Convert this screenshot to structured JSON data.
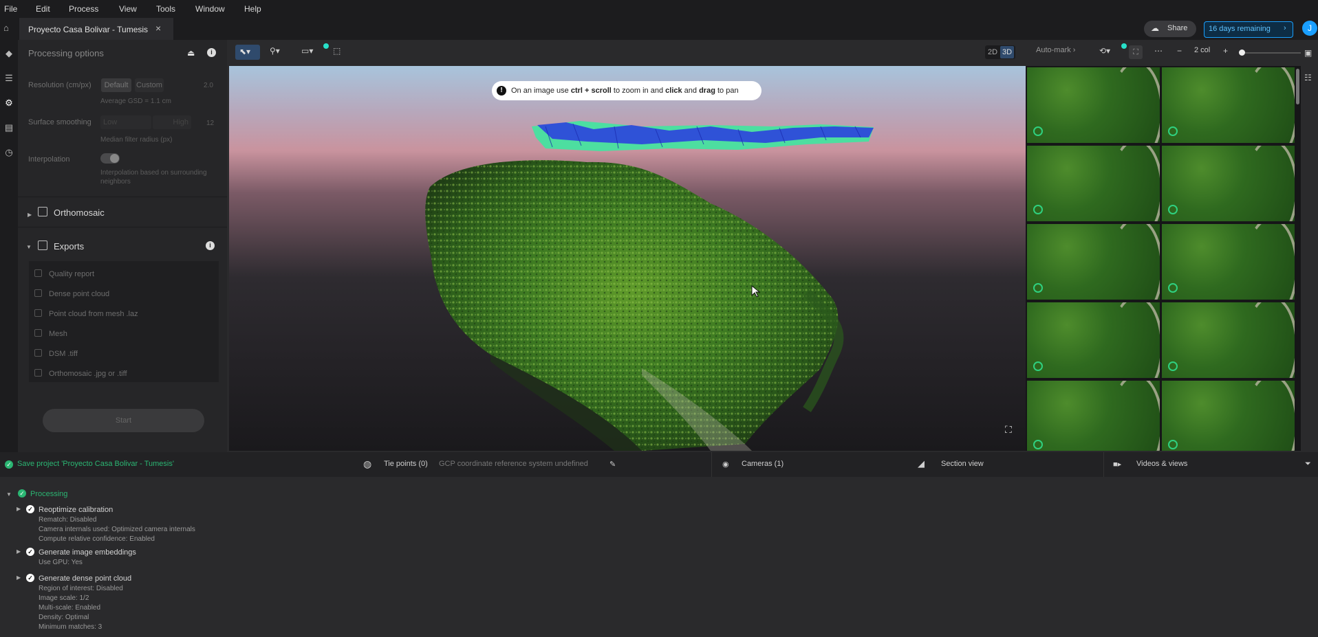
{
  "menu": [
    "File",
    "Edit",
    "Process",
    "View",
    "Tools",
    "Window",
    "Help"
  ],
  "tab": {
    "title": "Proyecto Casa Bolivar - Tumesis"
  },
  "header": {
    "share_label": "Share",
    "trial_label": "16 days remaining",
    "avatar_initial": "J"
  },
  "panel": {
    "title": "Processing options",
    "resolution_label": "Resolution (cm/px)",
    "resolution_default": "Default",
    "resolution_custom": "Custom",
    "resolution_value": "2.0",
    "avg_gsd": "Average GSD = 1.1 cm",
    "smoothing_label": "Surface smoothing",
    "smoothing_low": "Low",
    "smoothing_high": "High",
    "smoothing_value": "12",
    "smoothing_hint": "Median filter radius (px)",
    "interp_label": "Interpolation",
    "interp_hint_1": "Interpolation based on surrounding",
    "interp_hint_2": "neighbors",
    "ortho_label": "Orthomosaic",
    "exports_label": "Exports",
    "exports": [
      "Quality report",
      "Dense point cloud",
      "Point cloud from mesh .laz",
      "Mesh",
      "DSM .tiff",
      "Orthomosaic .jpg or .tiff"
    ],
    "start_label": "Start"
  },
  "toolbar": {
    "mode_2d": "2D",
    "mode_3d": "3D",
    "automark": "Auto-mark",
    "columns": "2 col"
  },
  "viewport": {
    "hint_prefix": "On an image use ",
    "hint_key1": "ctrl + scroll",
    "hint_mid": " to zoom in and ",
    "hint_key2": "click",
    "hint_and": " and ",
    "hint_key3": "drag",
    "hint_suffix": " to pan"
  },
  "bottom_bar": {
    "status": "Save project 'Proyecto Casa Bolivar - Tumesis'",
    "tie_points": "Tie points (0)",
    "crs": "GCP coordinate reference system undefined",
    "cameras": "Cameras (1)",
    "section_view": "Section view",
    "videos": "Videos & views"
  },
  "log": {
    "processing": "Processing",
    "step1_title": "Reoptimize calibration",
    "step1_lines": [
      "Rematch: Disabled",
      "Camera internals used: Optimized camera internals",
      "Compute relative confidence: Enabled"
    ],
    "step2_title": "Generate image embeddings",
    "step2_lines": [
      "Use GPU: Yes"
    ],
    "step3_title": "Generate dense point cloud",
    "step3_lines": [
      "Region of interest: Disabled",
      "Image scale: 1/2",
      "Multi-scale: Enabled",
      "Density: Optimal",
      "Minimum matches: 3"
    ]
  },
  "colors": {
    "accent": "#1aa0ff",
    "success": "#2bb673",
    "camera_overlay": "#4bff9e"
  }
}
